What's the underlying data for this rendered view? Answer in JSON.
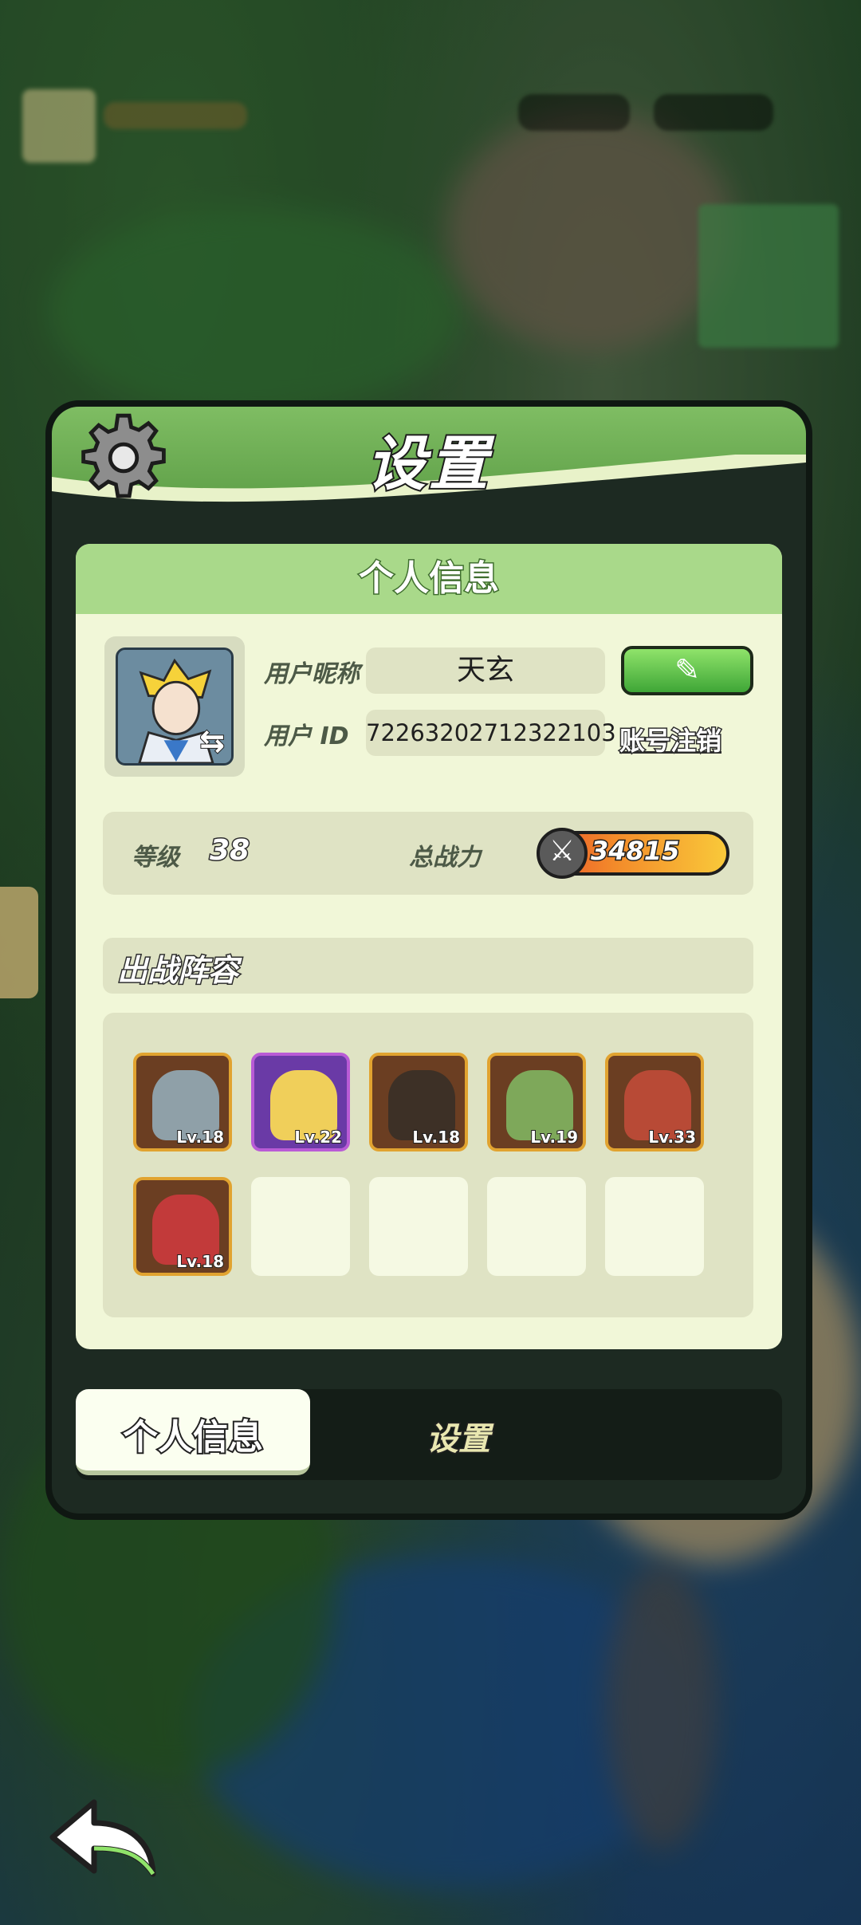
{
  "dialog": {
    "title": "设置",
    "section_title": "个人信息",
    "profile": {
      "nickname_label": "用户昵称",
      "nickname_value": "天玄",
      "id_label": "用户 ID",
      "id_value": "72263202712322103",
      "cancel_account_label": "账号注销",
      "edit_icon": "pencil-icon"
    },
    "stats": {
      "level_label": "等级",
      "level_value": "38",
      "power_label": "总战力",
      "power_value": "34815",
      "power_icon": "crossed-swords-icon"
    },
    "lineup": {
      "title": "出战阵容",
      "heroes": [
        {
          "level": "Lv.18",
          "frame": "gold"
        },
        {
          "level": "Lv.22",
          "frame": "purple"
        },
        {
          "level": "Lv.18",
          "frame": "gold"
        },
        {
          "level": "Lv.19",
          "frame": "gold"
        },
        {
          "level": "Lv.33",
          "frame": "gold"
        },
        {
          "level": "Lv.18",
          "frame": "gold"
        }
      ],
      "empty_slots": 4
    },
    "tabs": [
      {
        "label": "个人信息",
        "active": true
      },
      {
        "label": "设置",
        "active": false
      }
    ]
  },
  "colors": {
    "header_green": "#6fae54",
    "panel_bg": "#f1f7d8",
    "edit_button_green": "#4fb83f",
    "hero_frame_gold": "#e1a330",
    "hero_frame_purple": "#b95bd6"
  }
}
